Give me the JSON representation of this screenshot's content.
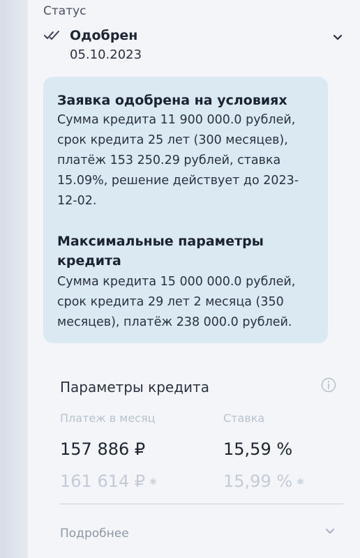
{
  "status": {
    "caption": "Статус",
    "title": "Одобрен",
    "date": "05.10.2023"
  },
  "note": {
    "approved_heading": "Заявка одобрена на условиях",
    "approved_lines": [
      "Сумма кредита 11 900 000.0 рублей,",
      "срок кредита 25 лет (300 месяцев),",
      "платёж 153 250.29 рублей, ставка",
      "15.09%, решение действует до 2023-",
      "12-02."
    ],
    "max_heading_lines": [
      "Максимальные параметры",
      "кредита"
    ],
    "max_lines": [
      "Сумма кредита 15 000 000.0 рублей,",
      "срок кредита 29 лет 2 месяца (350",
      "месяцев), платёж 238 000.0 рублей."
    ]
  },
  "params": {
    "title": "Параметры кредита",
    "col_payment_label": "Платеж в месяц",
    "col_rate_label": "Ставка",
    "payment_main": "157 886 ₽",
    "rate_main": "15,59 %",
    "payment_alt": "161 614 ₽",
    "rate_alt": "15,99 %",
    "more_label": "Подробнее"
  },
  "icons": {
    "status": "double-check-icon",
    "expand": "chevron-down-icon",
    "info": "info-icon",
    "alt_marker": "star-icon"
  }
}
